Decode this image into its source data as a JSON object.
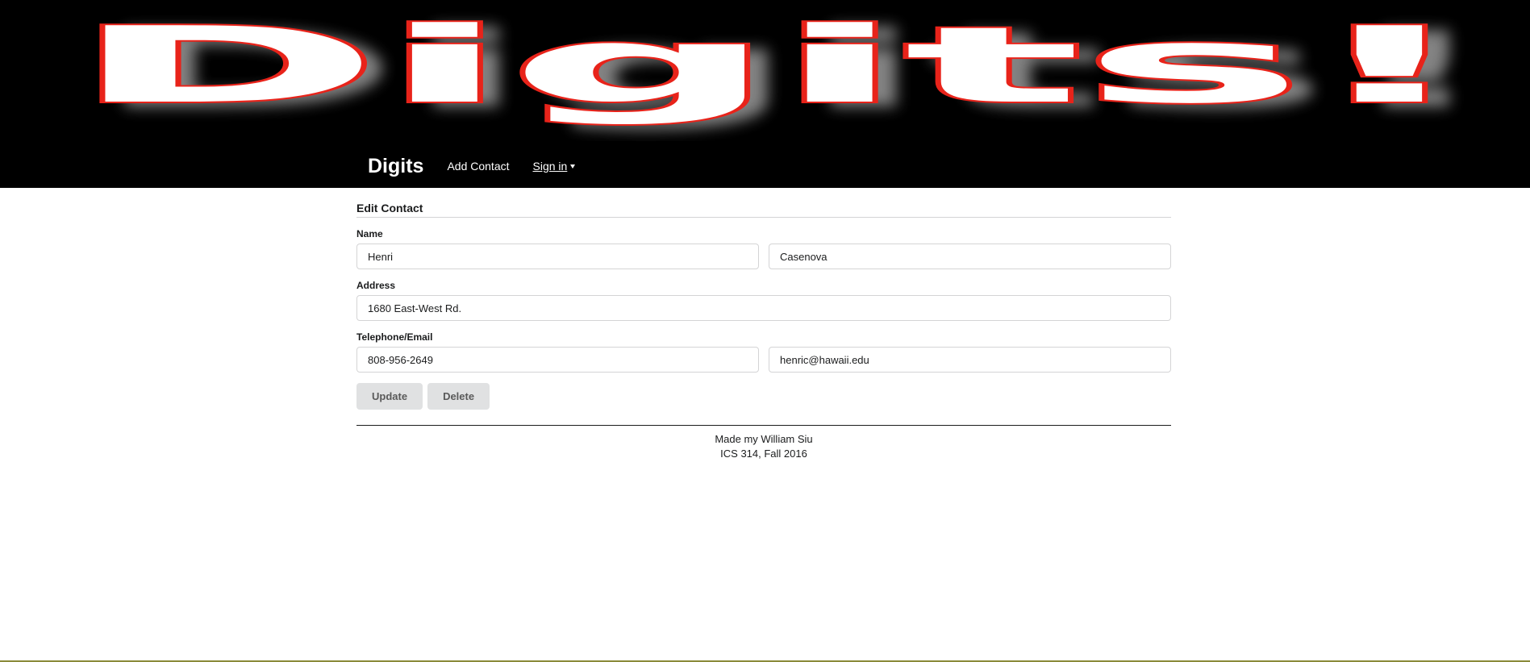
{
  "banner": {
    "text": "Digits!",
    "colors": {
      "fill": "#ffffff",
      "outline": "#e8231a",
      "shadow": "#777777",
      "background": "#000000"
    }
  },
  "nav": {
    "brand": "Digits",
    "add_contact": "Add Contact",
    "sign_in": "Sign in"
  },
  "form": {
    "title": "Edit Contact",
    "name_label": "Name",
    "first_name": "Henri",
    "last_name": "Casenova",
    "address_label": "Address",
    "address": "1680 East-West Rd.",
    "contact_label": "Telephone/Email",
    "telephone": "808-956-2649",
    "email": "henric@hawaii.edu",
    "update_label": "Update",
    "delete_label": "Delete"
  },
  "footer": {
    "line1": "Made my William Siu",
    "line2": "ICS 314, Fall 2016"
  }
}
